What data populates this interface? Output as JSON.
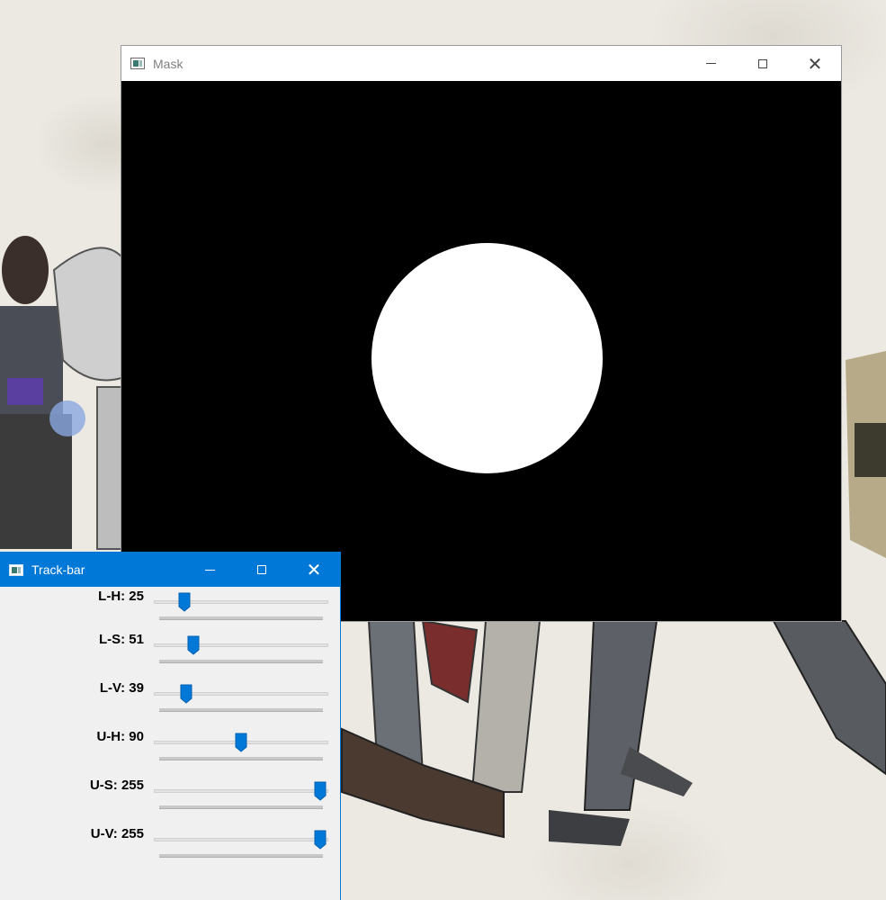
{
  "mask_window": {
    "title": "Mask",
    "controls": {
      "minimize": "minimize",
      "maximize": "maximize",
      "close": "close"
    }
  },
  "trackbar_window": {
    "title": "Track-bar",
    "sliders": [
      {
        "label": "L-H: 25",
        "value": 25,
        "max": 179
      },
      {
        "label": "L-S: 51",
        "value": 51,
        "max": 255
      },
      {
        "label": "L-V: 39",
        "value": 39,
        "max": 255
      },
      {
        "label": "U-H: 90",
        "value": 90,
        "max": 179
      },
      {
        "label": "U-S: 255",
        "value": 255,
        "max": 255
      },
      {
        "label": "U-V: 255",
        "value": 255,
        "max": 255
      }
    ]
  },
  "colors": {
    "accent": "#0078d7",
    "mask_background": "#000000",
    "mask_blob": "#ffffff"
  },
  "icons": [
    "app-icon",
    "minimize-icon",
    "maximize-icon",
    "close-icon",
    "slider-thumb-icon"
  ]
}
